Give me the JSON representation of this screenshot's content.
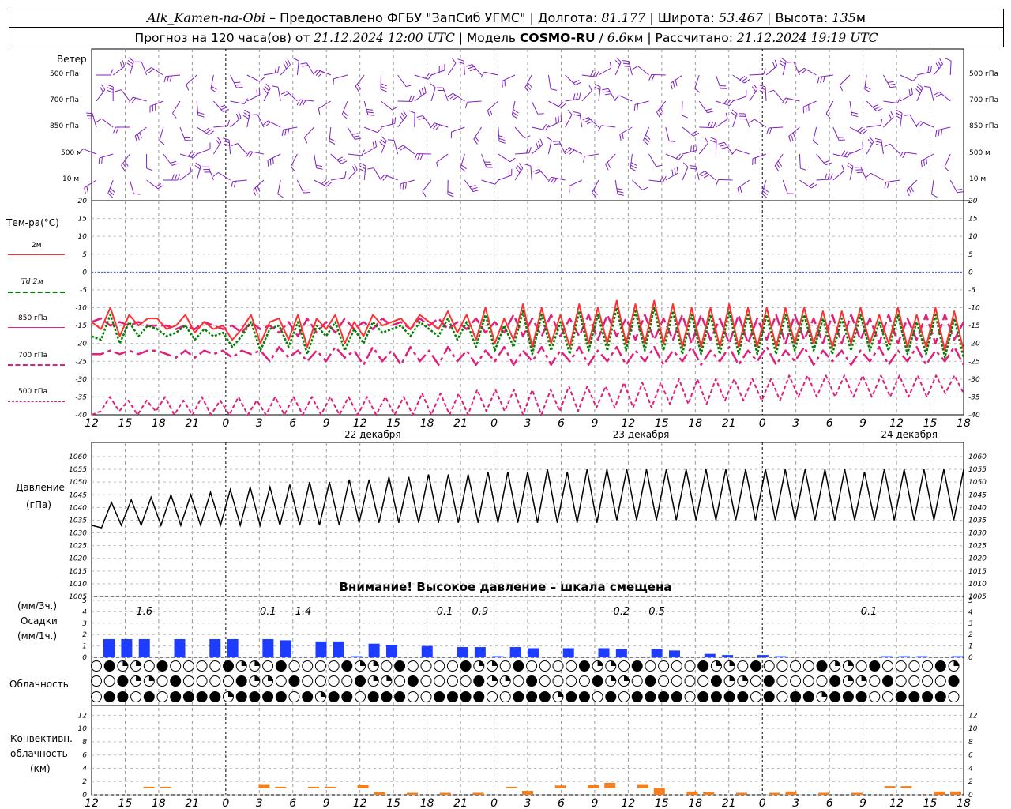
{
  "header": {
    "station": "Alk_Kamen-na-Obi",
    "provider_prefix": "– Предоставлено ФГБУ \"ЗапСиб УГМС\"",
    "lon_label": "| Долгота:",
    "lon_value": "81.177",
    "lat_label": "| Широта:",
    "lat_value": "53.467",
    "alt_label": "| Высота:",
    "alt_value": "135",
    "alt_unit": "м",
    "forecast_prefix": "Прогноз на 120 часа(ов) от",
    "forecast_from": "21.12.2024 12:00 UTC",
    "model_label": "| Модель",
    "model_name": "COSMO-RU",
    "model_sep": "/",
    "model_res": "6.6",
    "model_res_unit": "км",
    "calc_label": "| Рассчитано:",
    "calc_value": "21.12.2024 19:19 UTC"
  },
  "panels": {
    "wind": {
      "title": "Ветер",
      "levels": [
        "500 гПа",
        "700 гПа",
        "850 гПа",
        "500 м",
        "10 м"
      ]
    },
    "temp": {
      "title": "Тем-ра(°С)",
      "legend": [
        "2м",
        "Td 2м",
        "850 гПа",
        "700 гПа",
        "500 гПа"
      ]
    },
    "pressure": {
      "title_1": "Давление",
      "title_2": "(гПа)",
      "warning": "Внимание! Высокое давление – шкала смещена"
    },
    "precip": {
      "title_1": "(мм/3ч.)",
      "title_2": "Осадки",
      "title_3": "(мм/1ч.)"
    },
    "cloud": {
      "title": "Облачность"
    },
    "conv": {
      "title_1": "Конвективн.",
      "title_2": "облачность",
      "title_3": "(км)"
    }
  },
  "colors": {
    "t2m": "#ff3030",
    "td2m": "#008000",
    "t850": "#e0207a",
    "t700": "#e0207a",
    "t500": "#e0207a",
    "wind": "#8020c0",
    "pressure": "#000000",
    "precip": "#1e3cff",
    "conv": "#f08020",
    "zero_line": "#3050ff"
  },
  "chart_data": [
    {
      "type": "line",
      "name": "temperature",
      "x_ticks": [
        "12",
        "15",
        "18",
        "21",
        "0",
        "3",
        "6",
        "9",
        "12",
        "15",
        "18",
        "21",
        "0",
        "3",
        "6",
        "9",
        "12",
        "15",
        "18",
        "21",
        "0",
        "3",
        "6",
        "9",
        "12",
        "15",
        "18"
      ],
      "day_labels": [
        "22 декабря",
        "23 декабря",
        "24 декабря"
      ],
      "ylim": [
        -40,
        20
      ],
      "y_ticks": [
        20,
        15,
        10,
        5,
        0,
        -5,
        -10,
        -15,
        -20,
        -25,
        -30,
        -35,
        -40
      ],
      "series": [
        {
          "name": "2м",
          "values": [
            -14,
            -16,
            -10,
            -18,
            -12,
            -15,
            -13,
            -13,
            -16,
            -15,
            -12,
            -17,
            -14,
            -16,
            -15,
            -19,
            -16,
            -12,
            -20,
            -14,
            -13,
            -19,
            -12,
            -21,
            -13,
            -16,
            -12,
            -20,
            -14,
            -18,
            -12,
            -15,
            -14,
            -13,
            -16,
            -12,
            -14,
            -16,
            -11,
            -17,
            -12,
            -19,
            -10,
            -20,
            -13,
            -19,
            -9,
            -21,
            -10,
            -20,
            -12,
            -21,
            -9,
            -20,
            -10,
            -20,
            -8,
            -20,
            -9,
            -20,
            -8,
            -20,
            -9,
            -21,
            -10,
            -21,
            -10,
            -21,
            -9,
            -21,
            -10,
            -21,
            -10,
            -21,
            -10,
            -20,
            -10,
            -20,
            -11,
            -21,
            -11,
            -20,
            -10,
            -20,
            -12,
            -20,
            -10,
            -21,
            -12,
            -21,
            -10,
            -22,
            -11,
            -22
          ]
        },
        {
          "name": "Td 2м",
          "values": [
            -18,
            -19,
            -12,
            -20,
            -14,
            -18,
            -15,
            -16,
            -18,
            -17,
            -15,
            -19,
            -16,
            -18,
            -17,
            -21,
            -18,
            -14,
            -22,
            -16,
            -15,
            -21,
            -14,
            -23,
            -15,
            -18,
            -14,
            -22,
            -16,
            -20,
            -14,
            -17,
            -16,
            -15,
            -18,
            -14,
            -16,
            -18,
            -13,
            -19,
            -14,
            -21,
            -12,
            -22,
            -15,
            -21,
            -11,
            -23,
            -12,
            -22,
            -14,
            -23,
            -11,
            -22,
            -12,
            -22,
            -10,
            -22,
            -11,
            -22,
            -10,
            -22,
            -11,
            -23,
            -12,
            -23,
            -12,
            -23,
            -11,
            -23,
            -12,
            -23,
            -12,
            -23,
            -12,
            -22,
            -12,
            -22,
            -13,
            -23,
            -13,
            -22,
            -12,
            -22,
            -14,
            -22,
            -12,
            -23,
            -14,
            -23,
            -12,
            -24,
            -13,
            -24
          ]
        },
        {
          "name": "850 гПа",
          "values": [
            -14,
            -13,
            -15,
            -14,
            -15,
            -14,
            -15,
            -15,
            -15,
            -16,
            -15,
            -16,
            -14,
            -15,
            -16,
            -15,
            -17,
            -14,
            -16,
            -15,
            -17,
            -14,
            -18,
            -13,
            -17,
            -14,
            -17,
            -13,
            -16,
            -14,
            -16,
            -13,
            -15,
            -14,
            -16,
            -13,
            -15,
            -13,
            -16,
            -14,
            -16,
            -13,
            -17,
            -14,
            -17,
            -12,
            -18,
            -13,
            -18,
            -12,
            -18,
            -13,
            -18,
            -12,
            -19,
            -12,
            -18,
            -13,
            -19,
            -12,
            -19,
            -13,
            -19,
            -12,
            -20,
            -12,
            -19,
            -13,
            -20,
            -12,
            -20,
            -13,
            -19,
            -12,
            -20,
            -12,
            -19,
            -13,
            -20,
            -12,
            -20,
            -12,
            -19,
            -13,
            -20,
            -12,
            -20,
            -13,
            -19,
            -12,
            -20,
            -12,
            -19,
            -14
          ]
        },
        {
          "name": "700 гПа",
          "values": [
            -23,
            -23,
            -22,
            -23,
            -22,
            -23,
            -22,
            -22,
            -23,
            -24,
            -22,
            -24,
            -22,
            -23,
            -22,
            -24,
            -22,
            -23,
            -22,
            -25,
            -21,
            -24,
            -22,
            -25,
            -22,
            -25,
            -21,
            -24,
            -22,
            -26,
            -21,
            -25,
            -22,
            -26,
            -21,
            -25,
            -22,
            -26,
            -21,
            -25,
            -22,
            -26,
            -22,
            -25,
            -21,
            -26,
            -22,
            -25,
            -21,
            -26,
            -22,
            -25,
            -21,
            -26,
            -22,
            -25,
            -21,
            -26,
            -22,
            -25,
            -21,
            -26,
            -22,
            -25,
            -21,
            -26,
            -22,
            -25,
            -21,
            -26,
            -22,
            -25,
            -21,
            -26,
            -22,
            -25,
            -21,
            -26,
            -22,
            -25,
            -22,
            -26,
            -22,
            -25,
            -21,
            -26,
            -22,
            -25,
            -21,
            -26,
            -22,
            -25,
            -21,
            -26
          ]
        },
        {
          "name": "500 гПа",
          "values": [
            -40,
            -39,
            -35,
            -39,
            -36,
            -40,
            -36,
            -39,
            -35,
            -40,
            -36,
            -40,
            -35,
            -40,
            -36,
            -40,
            -35,
            -40,
            -36,
            -40,
            -35,
            -40,
            -35,
            -40,
            -35,
            -40,
            -35,
            -40,
            -35,
            -40,
            -35,
            -40,
            -35,
            -40,
            -35,
            -40,
            -34,
            -40,
            -34,
            -40,
            -34,
            -40,
            -33,
            -39,
            -33,
            -39,
            -33,
            -40,
            -33,
            -40,
            -33,
            -39,
            -32,
            -39,
            -32,
            -38,
            -32,
            -38,
            -31,
            -38,
            -31,
            -38,
            -31,
            -37,
            -30,
            -37,
            -30,
            -37,
            -30,
            -36,
            -30,
            -36,
            -30,
            -36,
            -30,
            -36,
            -29,
            -35,
            -29,
            -35,
            -29,
            -35,
            -29,
            -35,
            -29,
            -35,
            -29,
            -35,
            -29,
            -35,
            -29,
            -35,
            -29,
            -34,
            -29,
            -34
          ]
        }
      ]
    },
    {
      "type": "line",
      "name": "pressure",
      "ylim": [
        1005,
        1060
      ],
      "y_ticks": [
        1060,
        1055,
        1050,
        1045,
        1040,
        1035,
        1030,
        1025,
        1020,
        1015,
        1010,
        1005
      ],
      "values": [
        1033,
        1032,
        1042,
        1033,
        1043,
        1033,
        1044,
        1033,
        1045,
        1033,
        1045,
        1033,
        1046,
        1033,
        1047,
        1033,
        1048,
        1033,
        1048,
        1033,
        1049,
        1033,
        1050,
        1033,
        1050,
        1033,
        1051,
        1034,
        1051,
        1034,
        1052,
        1034,
        1052,
        1034,
        1053,
        1034,
        1053,
        1034,
        1053,
        1034,
        1054,
        1034,
        1054,
        1034,
        1054,
        1034,
        1055,
        1034,
        1054,
        1034,
        1055,
        1034,
        1055,
        1035,
        1055,
        1035,
        1055,
        1035,
        1055,
        1035,
        1055,
        1035,
        1055,
        1035,
        1055,
        1035,
        1055,
        1035,
        1055,
        1035,
        1055,
        1035,
        1055,
        1035,
        1055,
        1035,
        1055,
        1035,
        1054,
        1035,
        1055,
        1035,
        1055,
        1035,
        1055,
        1035,
        1055,
        1035,
        1055
      ]
    },
    {
      "type": "bar",
      "name": "precipitation",
      "ylim": [
        0,
        5
      ],
      "y_ticks": [
        5,
        4,
        3,
        2,
        1,
        0
      ],
      "values": [
        1.6,
        1.6,
        1.6,
        0,
        1.6,
        0,
        1.6,
        1.6,
        0,
        1.6,
        1.5,
        0,
        1.4,
        1.4,
        0.1,
        1.2,
        1.1,
        0,
        1.0,
        0,
        0.9,
        0.9,
        0.1,
        0.9,
        0.8,
        0,
        0.8,
        0,
        0.8,
        0.7,
        0,
        0.7,
        0.6,
        0,
        0.3,
        0.2,
        0,
        0.2,
        0.1,
        0,
        0,
        0,
        0,
        0,
        0.1,
        0.1,
        0.1,
        0,
        0.1
      ],
      "totals": [
        {
          "label": "1.6",
          "at": 2
        },
        {
          "label": "0.1",
          "at": 9
        },
        {
          "label": "1.4",
          "at": 11
        },
        {
          "label": "0.1",
          "at": 19
        },
        {
          "label": "0.9",
          "at": 21
        },
        {
          "label": "0.2",
          "at": 29
        },
        {
          "label": "0.5",
          "at": 31
        },
        {
          "label": "0.1",
          "at": 43
        }
      ]
    },
    {
      "type": "bar",
      "name": "convective cloud",
      "ylim": [
        0,
        13
      ],
      "y_ticks": [
        12,
        10,
        8,
        6,
        4,
        2,
        0
      ],
      "values": [
        0,
        0,
        0,
        1.2,
        1.2,
        0,
        0,
        0,
        0,
        0,
        1.6,
        1.2,
        0,
        1.2,
        1.2,
        0,
        1.5,
        0.4,
        0,
        0.3,
        0,
        0.3,
        0,
        0.3,
        0,
        1.2,
        0.6,
        0,
        1.4,
        0,
        1.5,
        1.8,
        0,
        1.6,
        1.0,
        0,
        0.5,
        0.4,
        0,
        0.3,
        0,
        0.3,
        0.5,
        0,
        0.3,
        0,
        0.3,
        0,
        1.3,
        1.3,
        0,
        0.5,
        0.5
      ]
    }
  ]
}
